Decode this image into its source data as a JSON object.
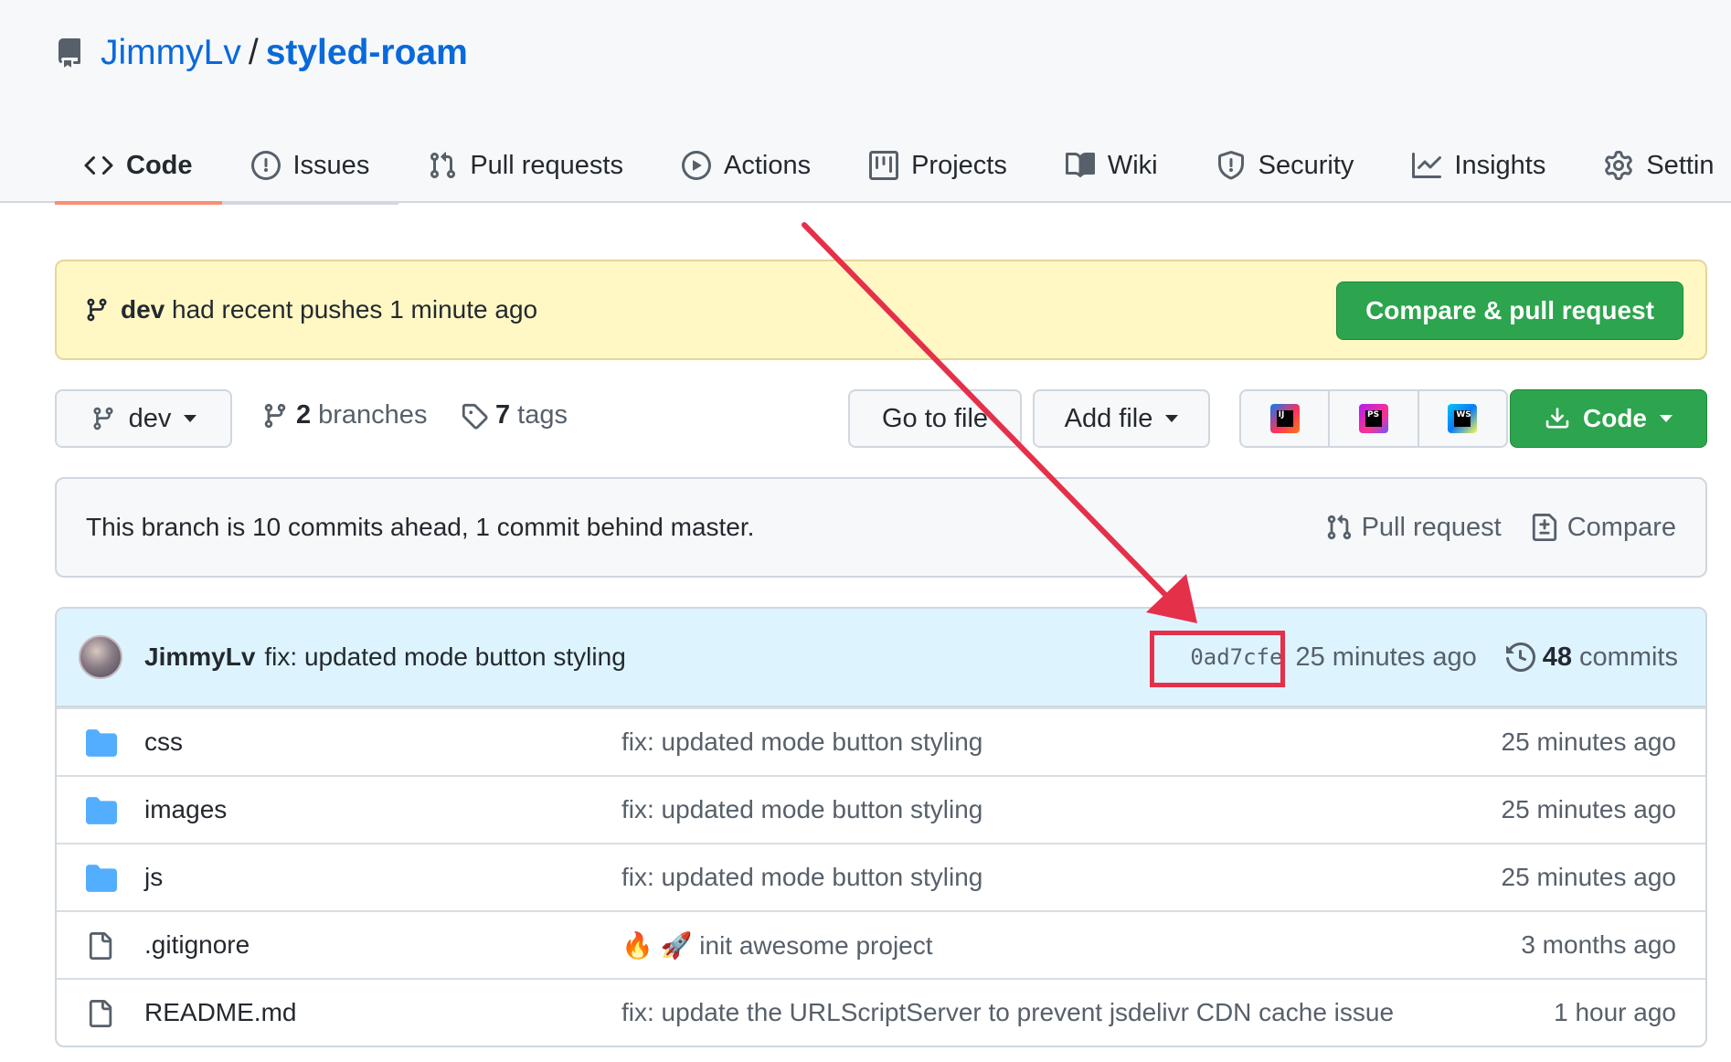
{
  "repo": {
    "owner": "JimmyLv",
    "separator": "/",
    "name": "styled-roam"
  },
  "tabs": [
    {
      "label": "Code",
      "icon": "code-icon"
    },
    {
      "label": "Issues",
      "icon": "issue-icon"
    },
    {
      "label": "Pull requests",
      "icon": "pull-request-icon"
    },
    {
      "label": "Actions",
      "icon": "play-icon"
    },
    {
      "label": "Projects",
      "icon": "project-icon"
    },
    {
      "label": "Wiki",
      "icon": "book-icon"
    },
    {
      "label": "Security",
      "icon": "shield-icon"
    },
    {
      "label": "Insights",
      "icon": "graph-icon"
    },
    {
      "label": "Settin",
      "icon": "gear-icon"
    }
  ],
  "flash": {
    "branch": "dev",
    "message": "had recent pushes 1 minute ago",
    "button": "Compare & pull request"
  },
  "toolbar": {
    "branch": "dev",
    "branches_count": "2",
    "branches_label": "branches",
    "tags_count": "7",
    "tags_label": "tags",
    "goto_file": "Go to file",
    "add_file": "Add file",
    "ide_buttons": [
      {
        "label": "IJ",
        "icon": "intellij-icon",
        "color": "#fe315d"
      },
      {
        "label": "PS",
        "icon": "phpstorm-icon",
        "color": "#b345f1"
      },
      {
        "label": "WS",
        "icon": "webstorm-icon",
        "color": "#07c3f2"
      }
    ],
    "code_button": "Code"
  },
  "branch_status": {
    "text": "This branch is 10 commits ahead, 1 commit behind master.",
    "pull_request": "Pull request",
    "compare": "Compare"
  },
  "latest_commit": {
    "author": "JimmyLv",
    "message": "fix: updated mode button styling",
    "sha": "0ad7cfe",
    "ago": "25 minutes ago",
    "commits_count": "48",
    "commits_label": "commits"
  },
  "files": [
    {
      "name": "css",
      "type": "folder",
      "message": "fix: updated mode button styling",
      "age": "25 minutes ago"
    },
    {
      "name": "images",
      "type": "folder",
      "message": "fix: updated mode button styling",
      "age": "25 minutes ago"
    },
    {
      "name": "js",
      "type": "folder",
      "message": "fix: updated mode button styling",
      "age": "25 minutes ago"
    },
    {
      "name": ".gitignore",
      "type": "file",
      "message": "🔥 🚀 init awesome project",
      "age": "3 months ago"
    },
    {
      "name": "README.md",
      "type": "file",
      "message": "fix: update the URLScriptServer to prevent jsdelivr CDN cache issue",
      "age": "1 hour ago"
    }
  ],
  "colors": {
    "accent_link": "#0969da",
    "primary_button": "#2da44e",
    "flash_bg": "#fff8c5",
    "commit_header_bg": "#ddf4ff",
    "annotation": "#e5304a",
    "folder": "#54aeff"
  }
}
